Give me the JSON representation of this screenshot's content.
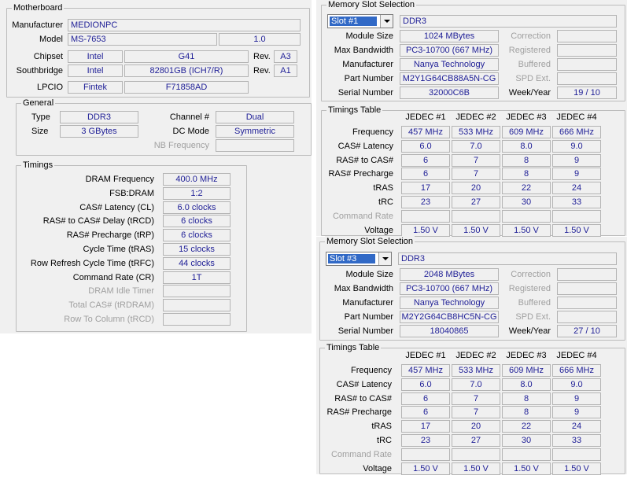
{
  "mainboard": {
    "section": "Motherboard",
    "manufacturer_label": "Manufacturer",
    "manufacturer": "MEDIONPC",
    "model_label": "Model",
    "model": "MS-7653",
    "model_rev": "1.0",
    "chipset_label": "Chipset",
    "chipset_vendor": "Intel",
    "chipset_model": "G41",
    "rev_label": "Rev.",
    "chipset_rev": "A3",
    "southbridge_label": "Southbridge",
    "southbridge_vendor": "Intel",
    "southbridge_model": "82801GB (ICH7/R)",
    "southbridge_rev": "A1",
    "lpcio_label": "LPCIO",
    "lpcio_vendor": "Fintek",
    "lpcio_model": "F71858AD"
  },
  "general": {
    "section": "General",
    "type_label": "Type",
    "type": "DDR3",
    "size_label": "Size",
    "size": "3 GBytes",
    "channel_label": "Channel #",
    "channel": "Dual",
    "dcmode_label": "DC Mode",
    "dcmode": "Symmetric",
    "nbfreq_label": "NB Frequency"
  },
  "timings": {
    "section": "Timings",
    "rows": [
      {
        "label": "DRAM Frequency",
        "value": "400.0 MHz"
      },
      {
        "label": "FSB:DRAM",
        "value": "1:2"
      },
      {
        "label": "CAS# Latency (CL)",
        "value": "6.0 clocks"
      },
      {
        "label": "RAS# to CAS# Delay (tRCD)",
        "value": "6 clocks"
      },
      {
        "label": "RAS# Precharge (tRP)",
        "value": "6 clocks"
      },
      {
        "label": "Cycle Time (tRAS)",
        "value": "15 clocks"
      },
      {
        "label": "Row Refresh Cycle Time (tRFC)",
        "value": "44 clocks"
      },
      {
        "label": "Command Rate (CR)",
        "value": "1T"
      },
      {
        "label": "DRAM Idle Timer",
        "value": ""
      },
      {
        "label": "Total CAS# (tRDRAM)",
        "value": ""
      },
      {
        "label": "Row To Column (tRCD)",
        "value": ""
      }
    ]
  },
  "slot_common": {
    "section": "Memory Slot Selection",
    "module_size_label": "Module Size",
    "max_bw_label": "Max Bandwidth",
    "manufacturer_label": "Manufacturer",
    "part_label": "Part Number",
    "serial_label": "Serial Number",
    "correction_label": "Correction",
    "registered_label": "Registered",
    "buffered_label": "Buffered",
    "spd_ext_label": "SPD Ext.",
    "week_year_label": "Week/Year",
    "timings_table_section": "Timings Table",
    "row_labels": [
      "Frequency",
      "CAS# Latency",
      "RAS# to CAS#",
      "RAS# Precharge",
      "tRAS",
      "tRC",
      "Command Rate",
      "Voltage"
    ],
    "jedec_headers": [
      "JEDEC #1",
      "JEDEC #2",
      "JEDEC #3",
      "JEDEC #4"
    ]
  },
  "slot1": {
    "slot": "Slot #1",
    "type": "DDR3",
    "module_size": "1024 MBytes",
    "max_bw": "PC3-10700 (667 MHz)",
    "manufacturer": "Nanya Technology",
    "part": "M2Y1G64CB88A5N-CG",
    "serial": "32000C6B",
    "week_year": "19 / 10",
    "table": [
      [
        "457 MHz",
        "533 MHz",
        "609 MHz",
        "666 MHz"
      ],
      [
        "6.0",
        "7.0",
        "8.0",
        "9.0"
      ],
      [
        "6",
        "7",
        "8",
        "9"
      ],
      [
        "6",
        "7",
        "8",
        "9"
      ],
      [
        "17",
        "20",
        "22",
        "24"
      ],
      [
        "23",
        "27",
        "30",
        "33"
      ],
      [
        "",
        "",
        "",
        ""
      ],
      [
        "1.50 V",
        "1.50 V",
        "1.50 V",
        "1.50 V"
      ]
    ]
  },
  "slot3": {
    "slot": "Slot #3",
    "type": "DDR3",
    "module_size": "2048 MBytes",
    "max_bw": "PC3-10700 (667 MHz)",
    "manufacturer": "Nanya Technology",
    "part": "M2Y2G64CB8HC5N-CG",
    "serial": "18040865",
    "week_year": "27 / 10",
    "table": [
      [
        "457 MHz",
        "533 MHz",
        "609 MHz",
        "666 MHz"
      ],
      [
        "6.0",
        "7.0",
        "8.0",
        "9.0"
      ],
      [
        "6",
        "7",
        "8",
        "9"
      ],
      [
        "6",
        "7",
        "8",
        "9"
      ],
      [
        "17",
        "20",
        "22",
        "24"
      ],
      [
        "23",
        "27",
        "30",
        "33"
      ],
      [
        "",
        "",
        "",
        ""
      ],
      [
        "1.50 V",
        "1.50 V",
        "1.50 V",
        "1.50 V"
      ]
    ]
  }
}
